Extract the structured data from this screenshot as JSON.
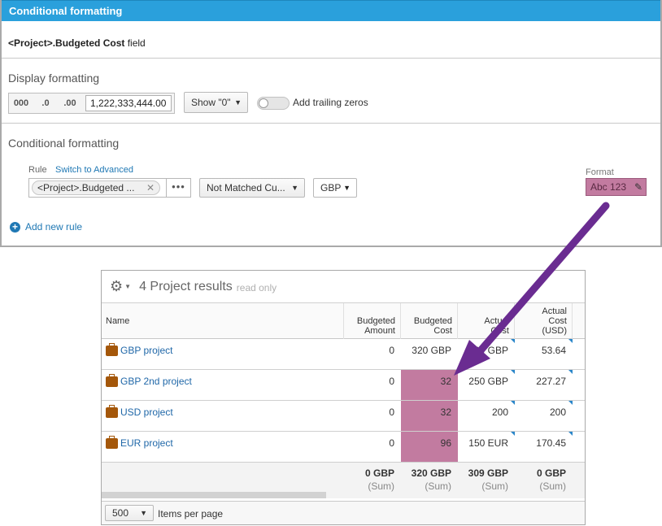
{
  "panel": {
    "title": "Conditional formatting",
    "field_name": "<Project>.Budgeted Cost",
    "field_suffix": "field",
    "display_title": "Display formatting",
    "fmt_buttons": [
      "000",
      ".0",
      ".00"
    ],
    "number_example": "1,222,333,444.00",
    "show_zero": "Show \"0\"",
    "trailing_zeros_label": "Add trailing zeros",
    "trailing_zeros_on": false,
    "conditional_title": "Conditional formatting",
    "rule_label": "Rule",
    "switch_label": "Switch to Advanced",
    "rule_field": "<Project>.Budgeted ...",
    "more": "•••",
    "operator": "Not Matched Cu...",
    "currency": "GBP",
    "format_label": "Format",
    "format_sample": "Abc 123",
    "format_color": "#c27ba0",
    "add_rule": "Add new rule"
  },
  "grid": {
    "title": "4 Project results",
    "mode": "read only",
    "columns": {
      "name": "Name",
      "budgeted_amount": [
        "Budgeted",
        "Amount"
      ],
      "budgeted_cost": [
        "Budgeted",
        "Cost"
      ],
      "actual_cost": [
        "Actual",
        "Cost"
      ],
      "actual_cost_usd": [
        "Actual",
        "Cost",
        "(USD)"
      ]
    },
    "rows": [
      {
        "name": "GBP project",
        "budgeted_amount": "0",
        "budgeted_cost": "320 GBP",
        "actual_cost": "309 GBP",
        "actual_cost_usd": "53.64",
        "highlight": false
      },
      {
        "name": "GBP 2nd project",
        "budgeted_amount": "0",
        "budgeted_cost": "32",
        "actual_cost": "250 GBP",
        "actual_cost_usd": "227.27",
        "highlight": true
      },
      {
        "name": "USD project",
        "budgeted_amount": "0",
        "budgeted_cost": "32",
        "actual_cost": "200",
        "actual_cost_usd": "200",
        "highlight": true
      },
      {
        "name": "EUR project",
        "budgeted_amount": "0",
        "budgeted_cost": "96",
        "actual_cost": "150 EUR",
        "actual_cost_usd": "170.45",
        "highlight": true
      }
    ],
    "sums": {
      "budgeted_amount": "0 GBP",
      "budgeted_cost": "320 GBP",
      "actual_cost": "309 GBP",
      "actual_cost_usd": "0 GBP",
      "label": "(Sum)"
    },
    "page_size": "500",
    "page_size_label": "Items per page"
  },
  "arrow_color": "#6a2c91"
}
